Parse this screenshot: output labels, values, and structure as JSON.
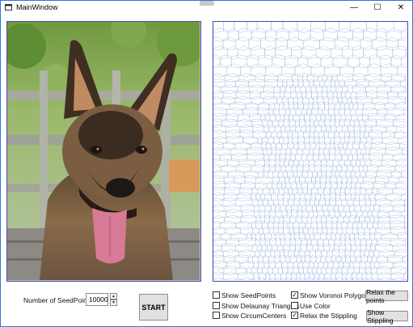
{
  "window": {
    "title": "MainWindow",
    "minimize_glyph": "—",
    "maximize_glyph": "☐",
    "close_glyph": "✕"
  },
  "icons": {
    "app": "window-icon",
    "minimize": "minimize-icon",
    "maximize": "maximize-icon",
    "close": "close-icon",
    "spin_up": "arrow-up-icon",
    "spin_down": "arrow-down-icon"
  },
  "images": {
    "left": "photo of a Belgian Malinois dog with tongue out, green foliage and wooden fence behind",
    "right": "Voronoi stippling of the same dog photo, light blue polygon cells on white"
  },
  "controls": {
    "seed_label": "Number of SeedPoints:",
    "seed_value": "10000",
    "spin_up_glyph": "▲",
    "spin_down_glyph": "▼",
    "start_label": "START",
    "relax_points_label": "Relax the points",
    "show_stippling_label": "Show Stippling"
  },
  "checkboxes": {
    "show_seedpoints": {
      "label": "Show SeedPoints",
      "checked": false
    },
    "show_delaunay": {
      "label": "Show Delaunay Triangles",
      "checked": false
    },
    "show_circumcenters": {
      "label": "Show CircumCenters",
      "checked": false
    },
    "show_voronoi": {
      "label": "Show Voronoi Polygons",
      "checked": true
    },
    "use_color": {
      "label": "Use Color",
      "checked": false
    },
    "relax_stippling": {
      "label": "Relax the Stippling",
      "checked": true
    }
  },
  "colors": {
    "frame_border": "#4b47b9",
    "window_border": "#2a78d4",
    "voronoi_line": "#a9c1dd",
    "button_face": "#e1e1e1"
  }
}
